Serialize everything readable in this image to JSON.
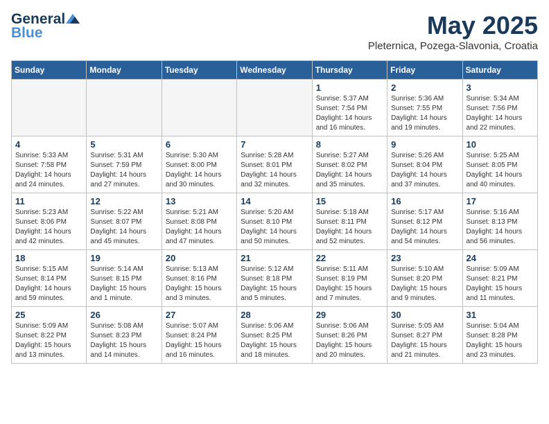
{
  "header": {
    "logo_general": "General",
    "logo_blue": "Blue",
    "month": "May 2025",
    "location": "Pleternica, Pozega-Slavonia, Croatia"
  },
  "weekdays": [
    "Sunday",
    "Monday",
    "Tuesday",
    "Wednesday",
    "Thursday",
    "Friday",
    "Saturday"
  ],
  "weeks": [
    [
      {
        "day": "",
        "info": ""
      },
      {
        "day": "",
        "info": ""
      },
      {
        "day": "",
        "info": ""
      },
      {
        "day": "",
        "info": ""
      },
      {
        "day": "1",
        "info": "Sunrise: 5:37 AM\nSunset: 7:54 PM\nDaylight: 14 hours\nand 16 minutes."
      },
      {
        "day": "2",
        "info": "Sunrise: 5:36 AM\nSunset: 7:55 PM\nDaylight: 14 hours\nand 19 minutes."
      },
      {
        "day": "3",
        "info": "Sunrise: 5:34 AM\nSunset: 7:56 PM\nDaylight: 14 hours\nand 22 minutes."
      }
    ],
    [
      {
        "day": "4",
        "info": "Sunrise: 5:33 AM\nSunset: 7:58 PM\nDaylight: 14 hours\nand 24 minutes."
      },
      {
        "day": "5",
        "info": "Sunrise: 5:31 AM\nSunset: 7:59 PM\nDaylight: 14 hours\nand 27 minutes."
      },
      {
        "day": "6",
        "info": "Sunrise: 5:30 AM\nSunset: 8:00 PM\nDaylight: 14 hours\nand 30 minutes."
      },
      {
        "day": "7",
        "info": "Sunrise: 5:28 AM\nSunset: 8:01 PM\nDaylight: 14 hours\nand 32 minutes."
      },
      {
        "day": "8",
        "info": "Sunrise: 5:27 AM\nSunset: 8:02 PM\nDaylight: 14 hours\nand 35 minutes."
      },
      {
        "day": "9",
        "info": "Sunrise: 5:26 AM\nSunset: 8:04 PM\nDaylight: 14 hours\nand 37 minutes."
      },
      {
        "day": "10",
        "info": "Sunrise: 5:25 AM\nSunset: 8:05 PM\nDaylight: 14 hours\nand 40 minutes."
      }
    ],
    [
      {
        "day": "11",
        "info": "Sunrise: 5:23 AM\nSunset: 8:06 PM\nDaylight: 14 hours\nand 42 minutes."
      },
      {
        "day": "12",
        "info": "Sunrise: 5:22 AM\nSunset: 8:07 PM\nDaylight: 14 hours\nand 45 minutes."
      },
      {
        "day": "13",
        "info": "Sunrise: 5:21 AM\nSunset: 8:08 PM\nDaylight: 14 hours\nand 47 minutes."
      },
      {
        "day": "14",
        "info": "Sunrise: 5:20 AM\nSunset: 8:10 PM\nDaylight: 14 hours\nand 50 minutes."
      },
      {
        "day": "15",
        "info": "Sunrise: 5:18 AM\nSunset: 8:11 PM\nDaylight: 14 hours\nand 52 minutes."
      },
      {
        "day": "16",
        "info": "Sunrise: 5:17 AM\nSunset: 8:12 PM\nDaylight: 14 hours\nand 54 minutes."
      },
      {
        "day": "17",
        "info": "Sunrise: 5:16 AM\nSunset: 8:13 PM\nDaylight: 14 hours\nand 56 minutes."
      }
    ],
    [
      {
        "day": "18",
        "info": "Sunrise: 5:15 AM\nSunset: 8:14 PM\nDaylight: 14 hours\nand 59 minutes."
      },
      {
        "day": "19",
        "info": "Sunrise: 5:14 AM\nSunset: 8:15 PM\nDaylight: 15 hours\nand 1 minute."
      },
      {
        "day": "20",
        "info": "Sunrise: 5:13 AM\nSunset: 8:16 PM\nDaylight: 15 hours\nand 3 minutes."
      },
      {
        "day": "21",
        "info": "Sunrise: 5:12 AM\nSunset: 8:18 PM\nDaylight: 15 hours\nand 5 minutes."
      },
      {
        "day": "22",
        "info": "Sunrise: 5:11 AM\nSunset: 8:19 PM\nDaylight: 15 hours\nand 7 minutes."
      },
      {
        "day": "23",
        "info": "Sunrise: 5:10 AM\nSunset: 8:20 PM\nDaylight: 15 hours\nand 9 minutes."
      },
      {
        "day": "24",
        "info": "Sunrise: 5:09 AM\nSunset: 8:21 PM\nDaylight: 15 hours\nand 11 minutes."
      }
    ],
    [
      {
        "day": "25",
        "info": "Sunrise: 5:09 AM\nSunset: 8:22 PM\nDaylight: 15 hours\nand 13 minutes."
      },
      {
        "day": "26",
        "info": "Sunrise: 5:08 AM\nSunset: 8:23 PM\nDaylight: 15 hours\nand 14 minutes."
      },
      {
        "day": "27",
        "info": "Sunrise: 5:07 AM\nSunset: 8:24 PM\nDaylight: 15 hours\nand 16 minutes."
      },
      {
        "day": "28",
        "info": "Sunrise: 5:06 AM\nSunset: 8:25 PM\nDaylight: 15 hours\nand 18 minutes."
      },
      {
        "day": "29",
        "info": "Sunrise: 5:06 AM\nSunset: 8:26 PM\nDaylight: 15 hours\nand 20 minutes."
      },
      {
        "day": "30",
        "info": "Sunrise: 5:05 AM\nSunset: 8:27 PM\nDaylight: 15 hours\nand 21 minutes."
      },
      {
        "day": "31",
        "info": "Sunrise: 5:04 AM\nSunset: 8:28 PM\nDaylight: 15 hours\nand 23 minutes."
      }
    ]
  ]
}
